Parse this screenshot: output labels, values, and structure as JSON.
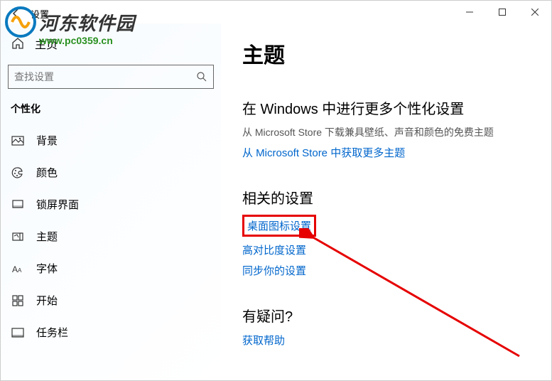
{
  "titlebar": {
    "back": "←",
    "title": "设置"
  },
  "sidebar": {
    "home_label": "主页",
    "search_placeholder": "查找设置",
    "category": "个性化",
    "items": [
      {
        "label": "背景"
      },
      {
        "label": "颜色"
      },
      {
        "label": "锁屏界面"
      },
      {
        "label": "主题"
      },
      {
        "label": "字体"
      },
      {
        "label": "开始"
      },
      {
        "label": "任务栏"
      }
    ]
  },
  "content": {
    "heading": "主题",
    "more_title": "在 Windows 中进行更多个性化设置",
    "more_desc": "从 Microsoft Store 下载兼具壁纸、声音和颜色的免费主题",
    "store_link": "从 Microsoft Store 中获取更多主题",
    "related_title": "相关的设置",
    "related_links": {
      "desktop_icons": "桌面图标设置",
      "high_contrast": "高对比度设置",
      "sync": "同步你的设置"
    },
    "help_title": "有疑问?",
    "help_link": "获取帮助"
  },
  "watermark": {
    "title": "河东软件园",
    "url": "www.pc0359.cn"
  }
}
